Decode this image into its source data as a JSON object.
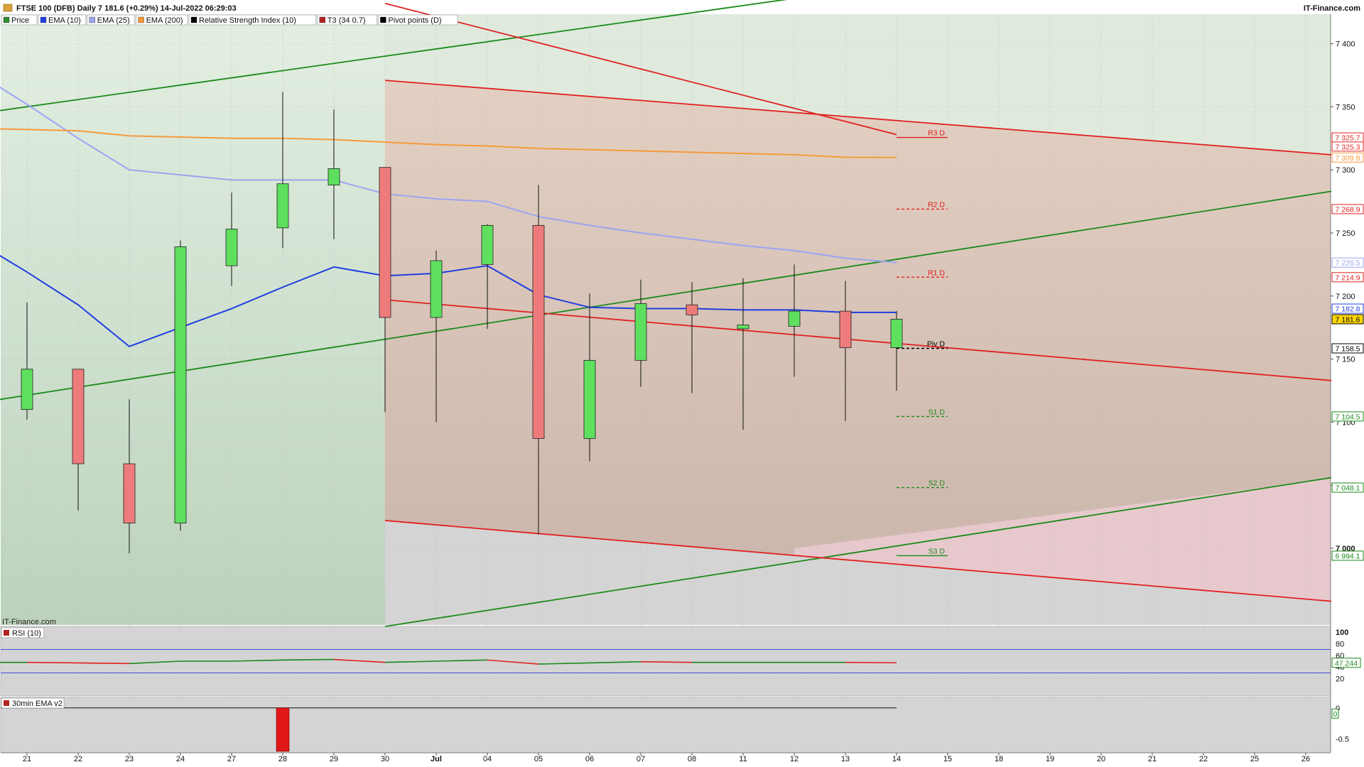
{
  "header": {
    "title": "FTSE 100 (DFB) Daily 7 181.6 (+0.29%) 14-Jul-2022 06:29:03",
    "brand": "IT-Finance.com"
  },
  "legend": [
    {
      "label": "Price",
      "color": "#2e8b2e"
    },
    {
      "label": "EMA (10)",
      "color": "#1f3fe0"
    },
    {
      "label": "EMA (25)",
      "color": "#9ca4f2"
    },
    {
      "label": "EMA (200)",
      "color": "#f59a3c"
    },
    {
      "label": "Relative Strength Index (10)",
      "color": "#000000"
    },
    {
      "label": "T3 (34 0.7)",
      "color": "#b22222"
    },
    {
      "label": "Pivot points (D)",
      "color": "#000000"
    }
  ],
  "watermark": "IT-Finance.com",
  "rsi_panel": {
    "label": "RSI (10)",
    "ticks": [
      "100",
      "80",
      "60",
      "40",
      "20"
    ],
    "value_label": "47.244"
  },
  "ema_panel": {
    "label": "30min EMA v2",
    "ticks": [
      "0",
      "-0.5"
    ],
    "value_label": "0"
  },
  "pivot_labels": [
    "R3 D",
    "R2 D",
    "R1 D",
    "Piv D",
    "S1 D",
    "S2 D",
    "S3 D"
  ],
  "price_tags": [
    {
      "text": "7 325.7",
      "price": 7325.7,
      "color": "#e02020"
    },
    {
      "text": "7 325.3",
      "price": 7318.5,
      "color": "#e02020"
    },
    {
      "text": "7 309.8",
      "price": 7309.8,
      "color": "#f59a3c"
    },
    {
      "text": "7 268.9",
      "price": 7268.9,
      "color": "#e02020"
    },
    {
      "text": "7 226.5",
      "price": 7226.5,
      "color": "#9ca4f2"
    },
    {
      "text": "7 214.9",
      "price": 7214.9,
      "color": "#e02020"
    },
    {
      "text": "7 182.8",
      "price": 7190.0,
      "color": "#1f3fe0"
    },
    {
      "text": "7 181.6",
      "price": 7181.6,
      "color": "#000000",
      "fill": "#ffd600"
    },
    {
      "text": "7 158.5",
      "price": 7158.5,
      "color": "#000000"
    },
    {
      "text": "7 104.5",
      "price": 7104.5,
      "color": "#1a8a1a"
    },
    {
      "text": "7 048.1",
      "price": 7048.1,
      "color": "#1a8a1a"
    },
    {
      "text": "6 994.1",
      "price": 6994.1,
      "color": "#1a8a1a"
    }
  ],
  "chart_data": {
    "type": "candlestick",
    "title": "FTSE 100 (DFB) Daily 7 181.6 (+0.29%) 14-Jul-2022 06:29:03",
    "ylim": [
      6938,
      7432
    ],
    "y_ticks": [
      {
        "label": "7 400",
        "value": 7400
      },
      {
        "label": "7 350",
        "value": 7350
      },
      {
        "label": "7 300",
        "value": 7300
      },
      {
        "label": "7 250",
        "value": 7250
      },
      {
        "label": "7 200",
        "value": 7200
      },
      {
        "label": "7 150",
        "value": 7150
      },
      {
        "label": "7 100",
        "value": 7100
      },
      {
        "label": "7 050",
        "value": 7050
      },
      {
        "label": "7 000",
        "value": 7000
      }
    ],
    "x_labels": [
      "21",
      "22",
      "23",
      "24",
      "27",
      "28",
      "29",
      "30",
      "Jul",
      "04",
      "05",
      "06",
      "07",
      "08",
      "11",
      "12",
      "13",
      "14",
      "15",
      "18",
      "19",
      "20",
      "21",
      "22",
      "25",
      "26"
    ],
    "candles": [
      {
        "date": "21",
        "open": 7110,
        "high": 7195,
        "low": 7102,
        "close": 7142
      },
      {
        "date": "22",
        "open": 7142,
        "high": 7142,
        "low": 7030,
        "close": 7067
      },
      {
        "date": "23",
        "open": 7067,
        "high": 7118,
        "low": 6996,
        "close": 7020
      },
      {
        "date": "24",
        "open": 7020,
        "high": 7244,
        "low": 7014,
        "close": 7239
      },
      {
        "date": "27",
        "open": 7224,
        "high": 7282,
        "low": 7208,
        "close": 7253
      },
      {
        "date": "28",
        "open": 7254,
        "high": 7362,
        "low": 7238,
        "close": 7289
      },
      {
        "date": "29",
        "open": 7288,
        "high": 7348,
        "low": 7245,
        "close": 7301
      },
      {
        "date": "30",
        "open": 7302,
        "high": 7302,
        "low": 7108,
        "close": 7183
      },
      {
        "date": "Jul",
        "open": 7183,
        "high": 7236,
        "low": 7100,
        "close": 7228
      },
      {
        "date": "04",
        "open": 7225,
        "high": 7257,
        "low": 7174,
        "close": 7256
      },
      {
        "date": "05",
        "open": 7256,
        "high": 7288,
        "low": 7011,
        "close": 7087
      },
      {
        "date": "06",
        "open": 7087,
        "high": 7202,
        "low": 7069,
        "close": 7149
      },
      {
        "date": "07",
        "open": 7149,
        "high": 7213,
        "low": 7128,
        "close": 7194
      },
      {
        "date": "08",
        "open": 7193,
        "high": 7211,
        "low": 7123,
        "close": 7185
      },
      {
        "date": "11",
        "open": 7174,
        "high": 7214,
        "low": 7094,
        "close": 7177
      },
      {
        "date": "12",
        "open": 7176,
        "high": 7225,
        "low": 7136,
        "close": 7188
      },
      {
        "date": "13",
        "open": 7188,
        "high": 7212,
        "low": 7101,
        "close": 7159
      },
      {
        "date": "14",
        "open": 7159,
        "high": 7188,
        "low": 7125,
        "close": 7181.6
      }
    ],
    "series": [
      {
        "name": "EMA (10)",
        "color": "#1f3fe0",
        "values": [
          7219,
          7193,
          7160,
          7175,
          7190,
          7207,
          7223,
          7216,
          7218,
          7224,
          7201,
          7191,
          7190,
          7190,
          7189,
          7189,
          7187,
          7187
        ]
      },
      {
        "name": "EMA (25)",
        "color": "#9ca4f2",
        "values": [
          7352,
          7325,
          7300,
          7296,
          7292,
          7292,
          7292,
          7281,
          7277,
          7275,
          7263,
          7256,
          7250,
          7245,
          7240,
          7236,
          7230,
          7226.5
        ]
      },
      {
        "name": "EMA (200)",
        "color": "#f59a3c",
        "values": [
          7332,
          7331,
          7327,
          7326,
          7325,
          7325,
          7324,
          7322,
          7320,
          7319,
          7317,
          7316,
          7315,
          7314,
          7313,
          7312,
          7310,
          7309.8
        ]
      }
    ],
    "pivots": [
      {
        "name": "R3 D",
        "value": 7325.7,
        "color": "#e02020"
      },
      {
        "name": "R2 D",
        "value": 7268.9,
        "color": "#e02020"
      },
      {
        "name": "R1 D",
        "value": 7214.9,
        "color": "#e02020"
      },
      {
        "name": "Piv D",
        "value": 7158.5,
        "color": "#000000"
      },
      {
        "name": "S1 D",
        "value": 7104.5,
        "color": "#1a8a1a"
      },
      {
        "name": "S2 D",
        "value": 7048.1,
        "color": "#1a8a1a"
      },
      {
        "name": "S3 D",
        "value": 6994.1,
        "color": "#1a8a1a"
      }
    ],
    "trendlines": [
      {
        "color": "#1a8a1a",
        "from": {
          "date": "start",
          "value": 7347
        },
        "to": {
          "date": "12",
          "value": 7436
        }
      },
      {
        "color": "#1a8a1a",
        "from": {
          "date": "start",
          "value": 7118
        },
        "to": {
          "date": "end",
          "value": 7283
        }
      },
      {
        "color": "#1a8a1a",
        "from": {
          "date": "30",
          "value": 6938
        },
        "to": {
          "date": "end",
          "value": 7056
        }
      },
      {
        "color": "#e02020",
        "from": {
          "date": "30",
          "value": 7432
        },
        "to": {
          "date": "14",
          "value": 7328
        }
      },
      {
        "color": "#e02020",
        "from": {
          "date": "30",
          "value": 7371
        },
        "to": {
          "date": "end",
          "value": 7312
        }
      },
      {
        "color": "#e02020",
        "from": {
          "date": "30",
          "value": 7197
        },
        "to": {
          "date": "end",
          "value": 7133
        }
      },
      {
        "color": "#e02020",
        "from": {
          "date": "30",
          "value": 7022
        },
        "to": {
          "date": "end",
          "value": 6958
        }
      }
    ],
    "rsi": {
      "ylim": [
        0,
        100
      ],
      "values": [
        48,
        47,
        46,
        50,
        50,
        52,
        53,
        48,
        50,
        52,
        45,
        47,
        49,
        48,
        48,
        48,
        48,
        47.244
      ],
      "overbought": 70,
      "oversold": 30
    },
    "ema_oscillator": {
      "ylim": [
        -0.7,
        0.1
      ],
      "bar": {
        "date": "28",
        "value": -0.7
      }
    }
  }
}
